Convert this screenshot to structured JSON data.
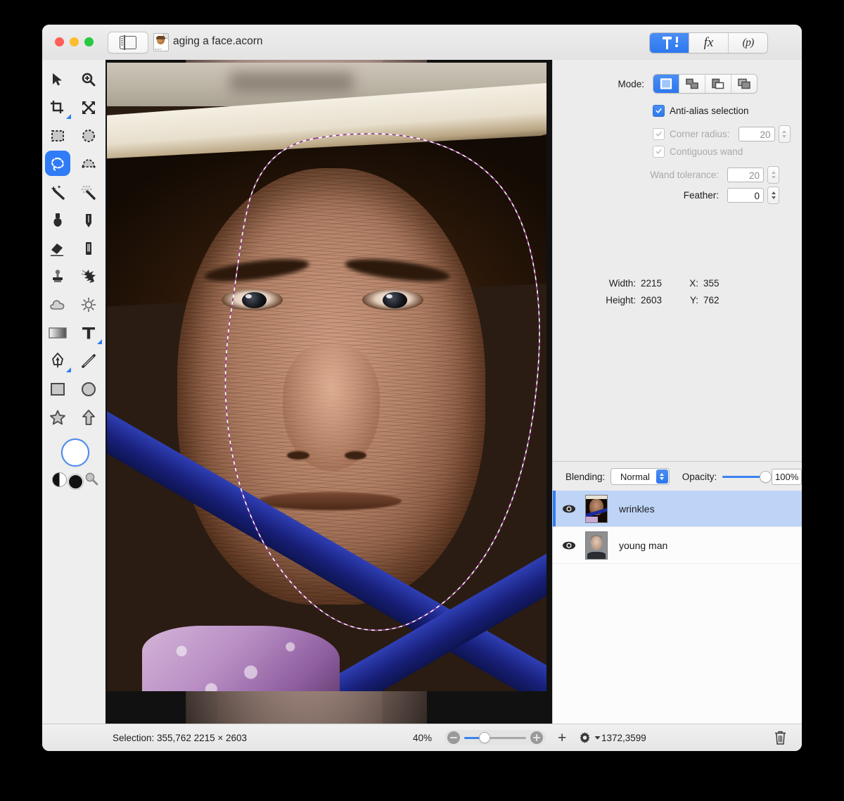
{
  "window": {
    "title": "aging a face.acorn",
    "traffic_lights": [
      "close",
      "minimize",
      "zoom"
    ],
    "sidebar_toggle": "sidebar-toggle",
    "segments": [
      {
        "id": "tools-inspector",
        "label": "",
        "icon": "hammer-tool-icon",
        "active": true
      },
      {
        "id": "filters-inspector",
        "label": "fx",
        "icon": "fx-icon",
        "active": false
      },
      {
        "id": "palette-inspector",
        "label": "(p)",
        "icon": "palette-icon",
        "active": false
      }
    ]
  },
  "tools": {
    "items": [
      {
        "name": "move-tool",
        "icon": "arrow-cursor-icon",
        "active": false
      },
      {
        "name": "zoom-tool",
        "icon": "magnifier-plus-icon",
        "active": false
      },
      {
        "name": "crop-tool",
        "icon": "crop-icon",
        "active": false,
        "has_options": true
      },
      {
        "name": "resize-tool",
        "icon": "move-arrows-icon",
        "active": false
      },
      {
        "name": "rectangle-select-tool",
        "icon": "marquee-rect-icon",
        "active": false
      },
      {
        "name": "ellipse-select-tool",
        "icon": "marquee-ellipse-icon",
        "active": false
      },
      {
        "name": "lasso-select-tool",
        "icon": "lasso-icon",
        "active": true
      },
      {
        "name": "polygon-select-tool",
        "icon": "polygon-lasso-icon",
        "active": false
      },
      {
        "name": "magic-wand-tool",
        "icon": "magic-wand-icon",
        "active": false
      },
      {
        "name": "instant-alpha-tool",
        "icon": "instant-alpha-icon",
        "active": false
      },
      {
        "name": "brush-tool",
        "icon": "paint-brush-icon",
        "active": false
      },
      {
        "name": "pencil-tool",
        "icon": "pencil-icon",
        "active": false
      },
      {
        "name": "eraser-tool",
        "icon": "eraser-icon",
        "active": false
      },
      {
        "name": "paint-bucket-tool",
        "icon": "paint-can-icon",
        "active": false
      },
      {
        "name": "clone-stamp-tool",
        "icon": "clone-stamp-icon",
        "active": false
      },
      {
        "name": "smudge-tool",
        "icon": "smudge-icon",
        "active": false
      },
      {
        "name": "blur-tool",
        "icon": "cloud-blur-icon",
        "active": false
      },
      {
        "name": "dodge-tool",
        "icon": "sun-dodge-icon",
        "active": false
      },
      {
        "name": "gradient-tool",
        "icon": "gradient-icon",
        "active": false
      },
      {
        "name": "text-tool",
        "icon": "text-t-icon",
        "active": false,
        "has_options": true
      },
      {
        "name": "bezier-pen-tool",
        "icon": "bezier-pen-icon",
        "active": false,
        "has_options": true
      },
      {
        "name": "line-tool",
        "icon": "line-icon",
        "active": false
      },
      {
        "name": "rectangle-shape-tool",
        "icon": "rectangle-shape-icon",
        "active": false
      },
      {
        "name": "ellipse-shape-tool",
        "icon": "ellipse-shape-icon",
        "active": false
      },
      {
        "name": "star-shape-tool",
        "icon": "star-shape-icon",
        "active": false
      },
      {
        "name": "arrow-shape-tool",
        "icon": "arrow-shape-icon",
        "active": false
      }
    ],
    "color_well": {
      "name": "foreground-color-well",
      "color": "#ffffff",
      "ring": "#4a8cf0"
    },
    "swatches": [
      {
        "name": "black-white-toggle-icon"
      },
      {
        "name": "black-swatch",
        "color": "#111111"
      },
      {
        "name": "color-picker-magnifier-icon"
      }
    ]
  },
  "inspector": {
    "mode_label": "Mode:",
    "modes": [
      {
        "name": "new-selection",
        "icon": "selection-new-icon",
        "active": true
      },
      {
        "name": "add-selection",
        "icon": "selection-add-icon",
        "active": false
      },
      {
        "name": "subtract-selection",
        "icon": "selection-subtract-icon",
        "active": false
      },
      {
        "name": "intersect-selection",
        "icon": "selection-intersect-icon",
        "active": false
      }
    ],
    "antialias": {
      "label": "Anti-alias selection",
      "checked": true,
      "enabled": true
    },
    "corner_radius": {
      "label": "Corner radius:",
      "checked": true,
      "enabled": false,
      "value": "20"
    },
    "contiguous_wand": {
      "label": "Contiguous wand",
      "checked": true,
      "enabled": false
    },
    "wand_tolerance": {
      "label": "Wand tolerance:",
      "enabled": false,
      "value": "20"
    },
    "feather": {
      "label": "Feather:",
      "enabled": true,
      "value": "0"
    },
    "dimensions": {
      "width_label": "Width:",
      "width_value": "2215",
      "height_label": "Height:",
      "height_value": "2603",
      "x_label": "X:",
      "x_value": "355",
      "y_label": "Y:",
      "y_value": "762"
    }
  },
  "layers_panel": {
    "blending_label": "Blending:",
    "blending_value": "Normal",
    "opacity_label": "Opacity:",
    "opacity_value": "100%",
    "opacity_percent": 100,
    "layers": [
      {
        "name": "wrinkles",
        "visible": true,
        "selected": true,
        "thumbnail": "old-woman-face-thumbnail"
      },
      {
        "name": "young man",
        "visible": true,
        "selected": false,
        "thumbnail": "young-man-face-thumbnail"
      }
    ]
  },
  "statusbar": {
    "selection_text": "Selection: 355,762 2215 × 2603",
    "zoom_level": "40%",
    "zoom_slider_percent": 26,
    "add_layer_label": "+",
    "gear_label": "gear-dropdown",
    "coordinates": "1372,3599",
    "trash_label": "delete-layer"
  },
  "canvas": {
    "document": "aging a face.acorn",
    "selection_outline": "lasso-selection-marching-ants",
    "image_subject": "elderly-woman-face-photo"
  },
  "colors": {
    "accent": "#2f7cf6",
    "selected_row": "#bed4f7",
    "panel_bg": "#ececec",
    "window_bg": "#ffffff"
  }
}
